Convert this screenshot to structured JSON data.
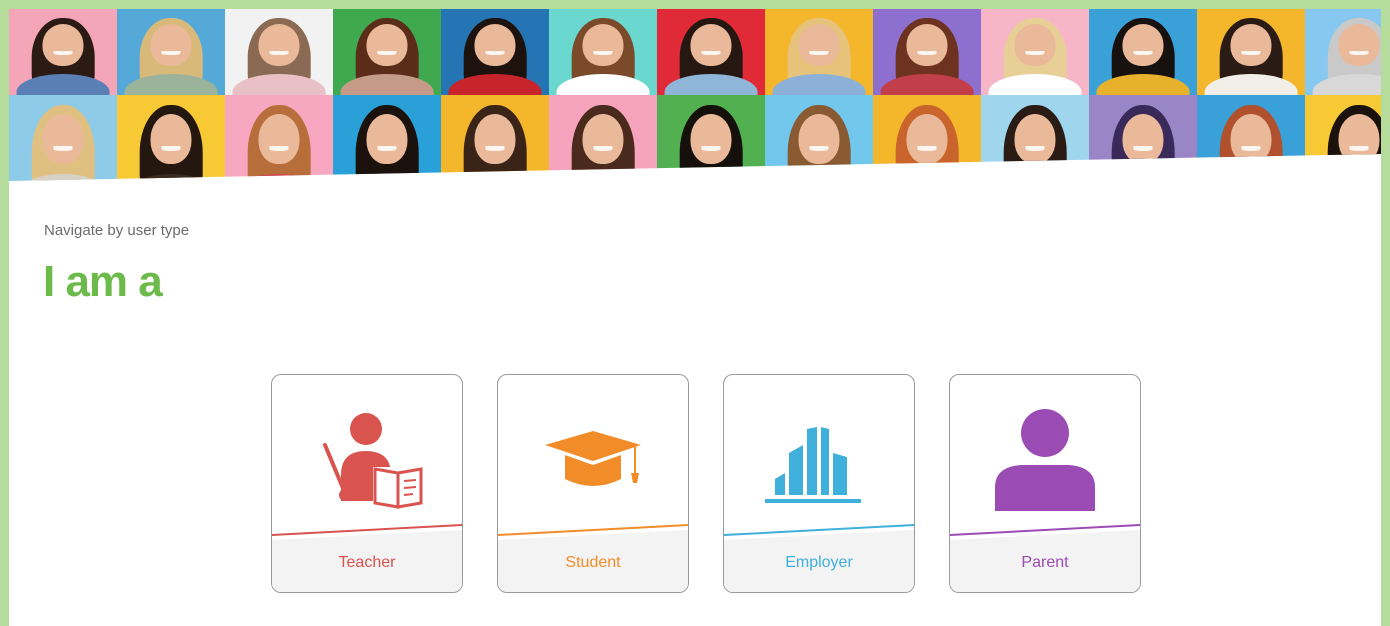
{
  "header": {
    "subtitle": "Navigate by user type",
    "title": "I am a"
  },
  "colors": {
    "frame": "#b5dc9a",
    "heading": "#6cba4a",
    "teacher": "#d9534f",
    "student": "#f28c28",
    "employer": "#3fb0dc",
    "parent": "#9b4bb4"
  },
  "cards": [
    {
      "label": "Teacher",
      "icon": "teacher-icon",
      "color": "#d9534f"
    },
    {
      "label": "Student",
      "icon": "graduation-cap-icon",
      "color": "#f28c28"
    },
    {
      "label": "Employer",
      "icon": "buildings-icon",
      "color": "#3fb0dc"
    },
    {
      "label": "Parent",
      "icon": "person-icon",
      "color": "#9b4bb4"
    }
  ]
}
